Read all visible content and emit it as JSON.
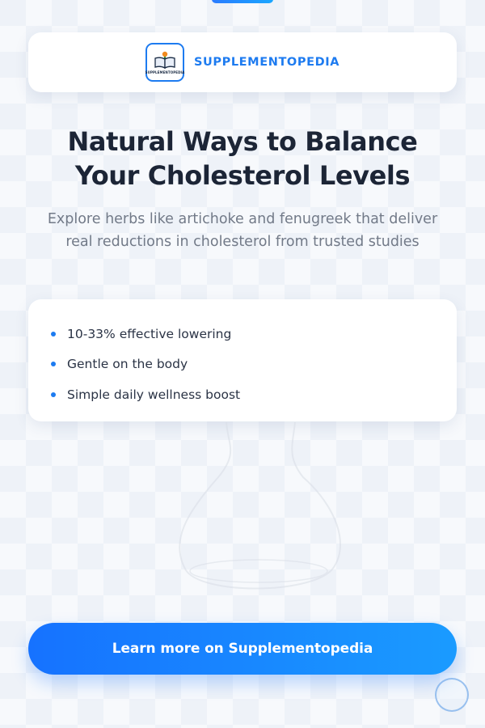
{
  "brand": {
    "name": "SUPPLEMENTOPEDIA",
    "logo_text": "SUPPLEMENTOPEDIA",
    "accent_color": "#1d7bf0",
    "logo_icon": "book-with-lightbulb-icon"
  },
  "hero": {
    "title_line1": "Natural Ways to Balance",
    "title_line2": "Your Cholesterol Levels",
    "subtitle": "Explore herbs like artichoke and fenugreek that deliver real reductions in cholesterol from trusted studies"
  },
  "features": [
    {
      "text": "10-33% effective lowering"
    },
    {
      "text": "Gentle on the body"
    },
    {
      "text": "Simple daily wellness boost"
    }
  ],
  "cta": {
    "label": "Learn more on Supplementopedia",
    "gradient_start": "#1672ff",
    "gradient_end": "#1a9bff"
  },
  "decor": {
    "background_image": "glass-bottle-icon",
    "scroll_button_icon": "circle-icon"
  }
}
